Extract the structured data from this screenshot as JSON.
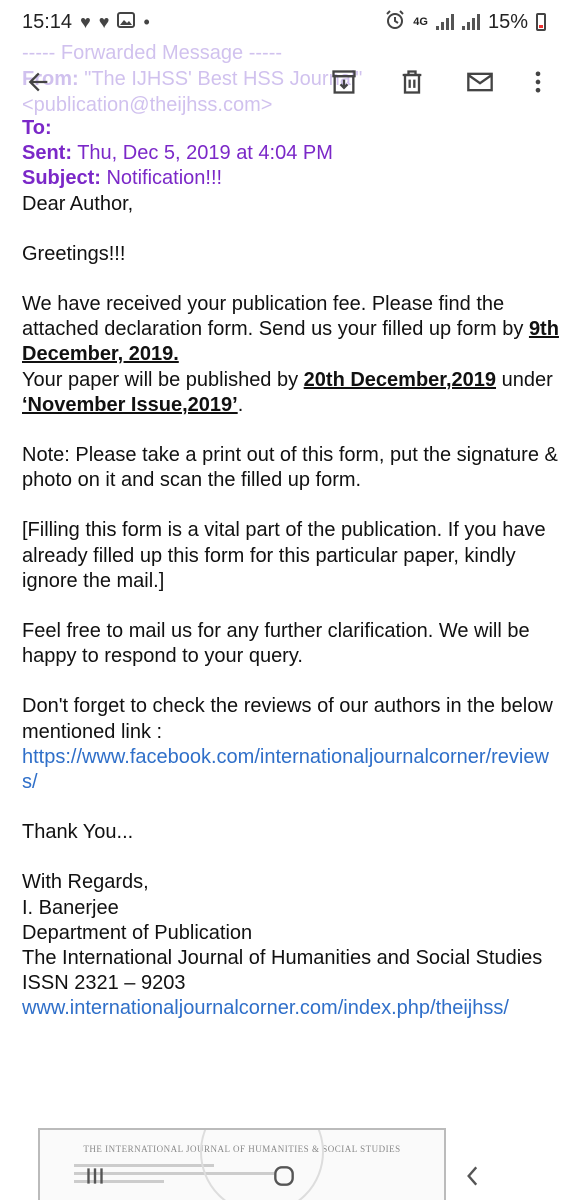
{
  "status_bar": {
    "time": "15:14",
    "network": "4G",
    "battery": "15%"
  },
  "forwarded_header": {
    "title": "----- Forwarded Message -----",
    "from_label": "From:",
    "from_value": "\"The IJHSS' Best HSS Journal\"",
    "from_email": "<publication@theijhss.com>"
  },
  "toolbar": {
    "icons": [
      "back-arrow-icon",
      "archive-icon",
      "trash-icon",
      "mail-icon",
      "more-vert-icon"
    ]
  },
  "header": {
    "to_label": "To:",
    "sent_label": "Sent:",
    "sent_value": "Thu, Dec 5, 2019 at 4:04 PM",
    "subject_label": "Subject:",
    "subject_value": "Notification!!!"
  },
  "body": {
    "salutation": "Dear Author,",
    "greeting": "Greetings!!!",
    "p1_part1": "We have received your publication fee. Please find the attached declaration form. Send us your filled up form by ",
    "p1_date": "9th December, 2019.",
    "p1_part2": "Your paper will be published by ",
    "p1_pubdate": "20th December,2019",
    "p1_part3": " under ",
    "p1_issue": "‘November Issue,2019’",
    "p1_end": ".",
    "note": "Note: Please take a print out of this form, put the signature & photo on it and scan the filled up form.",
    "bracket_note": "[Filling this form is a vital part of the publication. If you have already filled up this form for this particular paper, kindly ignore the mail.]",
    "feel_free": "Feel free to mail us for any further clarification. We will be happy to respond to your query.",
    "reviews_text": "Don't forget to check the reviews of our authors in the below mentioned link :",
    "reviews_link": "https://www.facebook.com/internationaljournalcorner/reviews/",
    "thanks": "Thank You...",
    "regards": "With Regards,",
    "signer": "I. Banerjee",
    "department": "Department of Publication",
    "journal": "The International Journal of Humanities and Social Studies",
    "issn": "ISSN 2321 – 9203",
    "website_link": "www.internationaljournalcorner.com/index.php/theijhss/"
  },
  "attachment": {
    "header_text": "THE INTERNATIONAL JOURNAL OF HUMANITIES & SOCIAL STUDIES"
  },
  "nav_bar": {
    "icons": [
      "recent-apps-icon",
      "home-icon",
      "back-icon"
    ]
  }
}
